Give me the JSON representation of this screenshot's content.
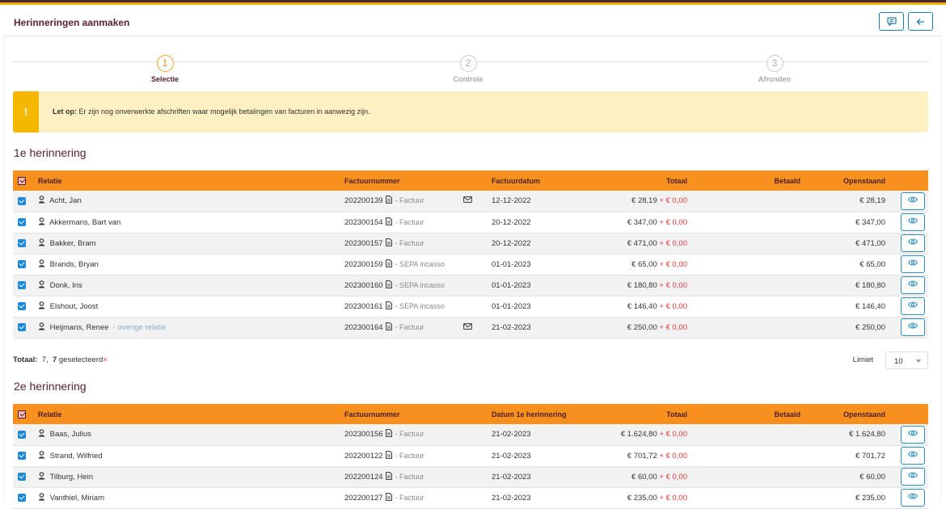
{
  "header": {
    "title": "Herinneringen aanmaken",
    "icons": [
      "comment-icon",
      "arrow-left-icon"
    ]
  },
  "steps": [
    {
      "num": "1",
      "label": "Selectie",
      "active": true
    },
    {
      "num": "2",
      "label": "Controle",
      "active": false
    },
    {
      "num": "3",
      "label": "Afronden",
      "active": false
    }
  ],
  "alert": {
    "icon": "!",
    "bold": "Let op:",
    "text": " Er zijn nog onverwerkte afschriften waar mogelijk betalingen van facturen in aanwezig zijn."
  },
  "section1": {
    "title": "1e herinnering",
    "columns": {
      "relatie": "Relatie",
      "factuurnummer": "Factuurnummer",
      "datum": "Factuurdatum",
      "totaal": "Totaal",
      "betaald": "Betaald",
      "openstaand": "Openstaand"
    },
    "rows": [
      {
        "name": "Acht, Jan",
        "extra": "",
        "nr": "202200139",
        "type": "- Factuur",
        "mail": true,
        "date": "12-12-2022",
        "total": "€ 28,19",
        "plus": "+ € 0,00",
        "paid": "",
        "open": "€ 28,19"
      },
      {
        "name": "Akkermans, Bart van",
        "extra": "",
        "nr": "202300154",
        "type": "- Factuur",
        "mail": false,
        "date": "20-12-2022",
        "total": "€ 347,00",
        "plus": "+ € 0,00",
        "paid": "",
        "open": "€ 347,00"
      },
      {
        "name": "Bakker, Bram",
        "extra": "",
        "nr": "202300157",
        "type": "- Factuur",
        "mail": false,
        "date": "20-12-2022",
        "total": "€ 471,00",
        "plus": "+ € 0,00",
        "paid": "",
        "open": "€ 471,00"
      },
      {
        "name": "Brands, Bryan",
        "extra": "",
        "nr": "202300159",
        "type": "- SEPA incasso",
        "mail": false,
        "date": "01-01-2023",
        "total": "€ 65,00",
        "plus": "+ € 0,00",
        "paid": "",
        "open": "€ 65,00"
      },
      {
        "name": "Donk, Iris",
        "extra": "",
        "nr": "202300160",
        "type": "- SEPA incasso",
        "mail": false,
        "date": "01-01-2023",
        "total": "€ 180,80",
        "plus": "+ € 0,00",
        "paid": "",
        "open": "€ 180,80"
      },
      {
        "name": "Elshout, Joost",
        "extra": "",
        "nr": "202300161",
        "type": "- SEPA incasso",
        "mail": false,
        "date": "01-01-2023",
        "total": "€ 146,40",
        "plus": "+ € 0,00",
        "paid": "",
        "open": "€ 146,40"
      },
      {
        "name": "Heijmans, Renee",
        "extra": "- overige relatie",
        "nr": "202300164",
        "type": "- Factuur",
        "mail": true,
        "date": "21-02-2023",
        "total": "€ 250,00",
        "plus": "+ € 0,00",
        "paid": "",
        "open": "€ 250,00"
      }
    ],
    "footer": {
      "label": "Totaal:",
      "count": "7,",
      "selected_count": "7",
      "selected_text": "geselecteerd",
      "clear": "×",
      "limit_label": "Limiet",
      "limit_value": "10"
    }
  },
  "section2": {
    "title": "2e herinnering",
    "columns": {
      "relatie": "Relatie",
      "factuurnummer": "Factuurnummer",
      "datum": "Datum 1e herinnering",
      "totaal": "Totaal",
      "betaald": "Betaald",
      "openstaand": "Openstaand"
    },
    "rows": [
      {
        "name": "Baas, Julius",
        "extra": "",
        "nr": "202300156",
        "type": "- Factuur",
        "mail": false,
        "date": "21-02-2023",
        "total": "€ 1.624,80",
        "plus": "+ € 0,00",
        "paid": "",
        "open": "€ 1.624,80"
      },
      {
        "name": "Strand, Wilfried",
        "extra": "",
        "nr": "202200122",
        "type": "- Factuur",
        "mail": false,
        "date": "21-02-2023",
        "total": "€ 701,72",
        "plus": "+ € 0,00",
        "paid": "",
        "open": "€ 701,72"
      },
      {
        "name": "Tilburg, Hein",
        "extra": "",
        "nr": "202200124",
        "type": "- Factuur",
        "mail": false,
        "date": "21-02-2023",
        "total": "€ 60,00",
        "plus": "+ € 0,00",
        "paid": "",
        "open": "€ 60,00"
      },
      {
        "name": "Vanthiel, Miriam",
        "extra": "",
        "nr": "202200127",
        "type": "- Factuur",
        "mail": false,
        "date": "21-02-2023",
        "total": "€ 235,00",
        "plus": "+ € 0,00",
        "paid": "",
        "open": "€ 235,00"
      }
    ]
  },
  "colors": {
    "accent": "#f7901e",
    "brand": "#5a2136",
    "link": "#2a8fc1",
    "warning": "#f5b800",
    "negative": "#e23a3a"
  }
}
